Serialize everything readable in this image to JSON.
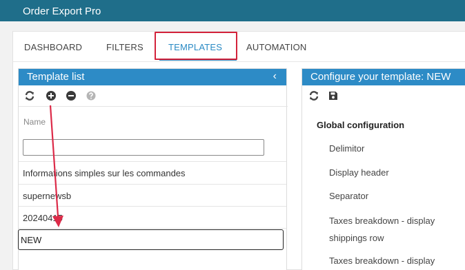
{
  "app": {
    "title": "Order Export Pro"
  },
  "tabs": [
    {
      "label": "DASHBOARD"
    },
    {
      "label": "FILTERS"
    },
    {
      "label": "TEMPLATES"
    },
    {
      "label": "AUTOMATION"
    }
  ],
  "active_tab": "TEMPLATES",
  "left_panel": {
    "title": "Template list",
    "collapse_glyph": "‹",
    "toolbar": [
      "refresh-icon",
      "add-circle-icon",
      "remove-circle-icon",
      "help-icon"
    ],
    "column_label": "Name",
    "name_input_value": "",
    "items": [
      {
        "label": "Informations simples sur les commandes"
      },
      {
        "label": "supernewsb"
      },
      {
        "label": "20240415"
      }
    ],
    "editing_value": "NEW"
  },
  "right_panel": {
    "title": "Configure your template: NEW",
    "toolbar": [
      "refresh-icon",
      "save-icon"
    ],
    "section_title": "Global configuration",
    "items": [
      {
        "label": "Delimitor"
      },
      {
        "label": "Display header"
      },
      {
        "label": "Separator"
      },
      {
        "label": "Taxes breakdown - display shippings row"
      },
      {
        "label": "Taxes breakdown - display"
      }
    ]
  },
  "colors": {
    "titlebar": "#1f6e8a",
    "panel_header": "#2d8bc6",
    "tab_active": "#2a8ac4",
    "highlight_box": "#d3223a",
    "annotation_arrow": "#dc2a48"
  }
}
